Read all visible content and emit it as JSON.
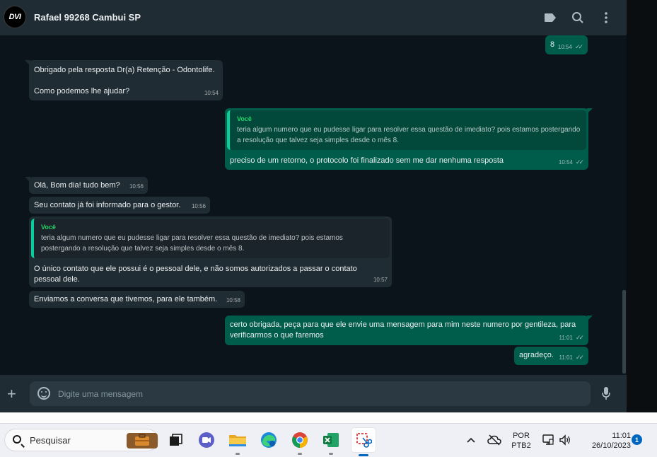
{
  "header": {
    "avatar_text": "DVI",
    "contact_name": "Rafael 99268 Cambui SP",
    "icons": [
      "label-icon",
      "search-icon",
      "menu-dots-icon"
    ]
  },
  "messages": [
    {
      "dir": "out",
      "text": "8",
      "time": "10:54",
      "status": "read"
    },
    {
      "dir": "in",
      "text": "Obrigado pela resposta Dr(a) Retenção - Odontolife.\n\nComo podemos lhe ajudar?",
      "time": "10:54"
    },
    {
      "dir": "out",
      "quote_author": "Você",
      "quote_text": "teria algum numero que eu pudesse ligar para resolver essa questão de imediato? pois estamos postergando a resolução que talvez seja simples desde o mês 8.",
      "text": "preciso de um retorno, o protocolo foi finalizado sem me dar nenhuma resposta",
      "time": "10:54",
      "status": "read"
    },
    {
      "dir": "in",
      "text": "Olá, Bom dia! tudo bem?",
      "time": "10:56"
    },
    {
      "dir": "in",
      "text": "Seu contato já foi informado para o gestor.",
      "time": "10:56"
    },
    {
      "dir": "in",
      "quote_author": "Você",
      "quote_text": "teria algum numero que eu pudesse ligar para resolver essa questão de imediato? pois estamos postergando a resolução que talvez seja simples desde o mês 8.",
      "text": "O único contato que ele possui é o pessoal dele, e não somos autorizados a passar o contato pessoal dele.",
      "time": "10:57"
    },
    {
      "dir": "in",
      "text": "Enviamos a conversa que tivemos, para ele também.",
      "time": "10:58"
    },
    {
      "dir": "out",
      "text": "certo obrigada, peça para que ele envie uma mensagem para mim neste numero por gentileza, para verificarmos o que faremos",
      "time": "11:01",
      "status": "read"
    },
    {
      "dir": "out",
      "text": "agradeço.",
      "time": "11:01",
      "status": "read"
    }
  ],
  "composer": {
    "placeholder": "Digite uma mensagem",
    "icons": [
      "plus-icon",
      "emoji-icon",
      "microphone-icon"
    ]
  },
  "taskbar": {
    "search_label": "Pesquisar",
    "apps": [
      "widgets",
      "task-view",
      "teams",
      "file-explorer",
      "edge",
      "chrome",
      "excel",
      "snipping-tool"
    ],
    "language": "POR",
    "keyboard": "PTB2",
    "time": "11:01",
    "date": "26/10/2023",
    "notification_count": "1"
  },
  "colors": {
    "incoming_bubble": "#202c33",
    "outgoing_bubble": "#005c4b",
    "chat_background": "#0b141a",
    "header_background": "#202c33",
    "quote_author": "#25d366"
  }
}
